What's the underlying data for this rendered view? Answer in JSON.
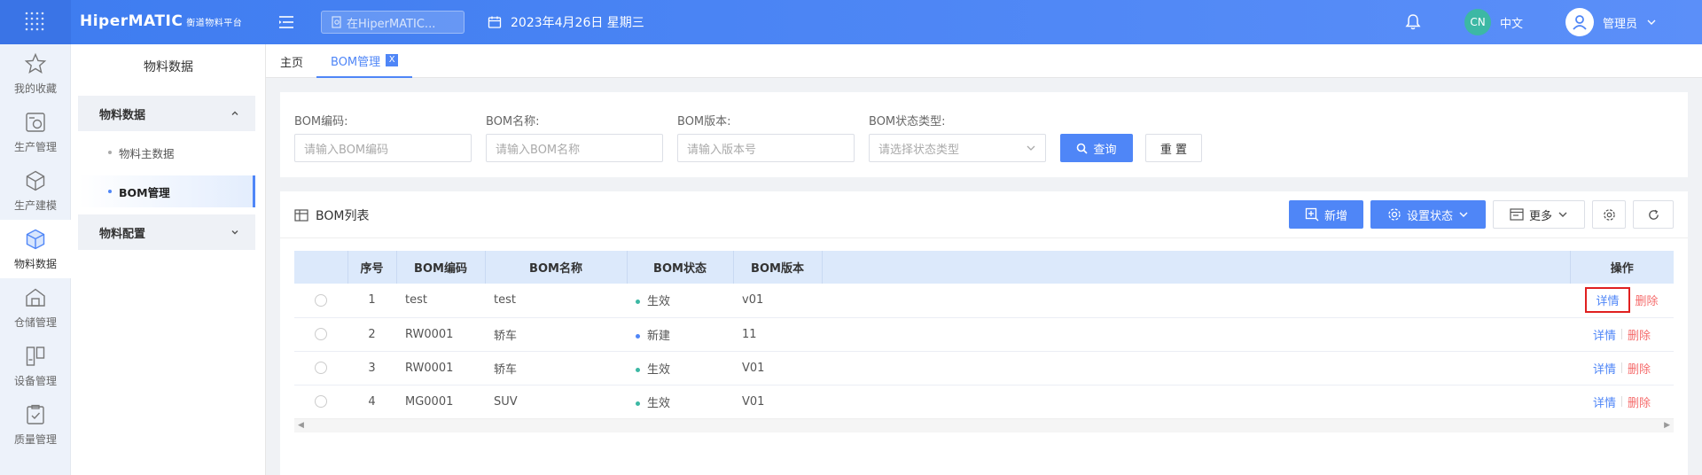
{
  "header": {
    "logo_main": "HiperMATIC",
    "logo_sub": "衡道物料平台",
    "search_placeholder": "在HiperMATIC...",
    "date_text": "2023年4月26日 星期三",
    "lang_badge": "CN",
    "lang_label": "中文",
    "user_name": "管理员"
  },
  "rail": {
    "items": [
      {
        "label": "我的收藏",
        "icon": "star-icon"
      },
      {
        "label": "生产管理",
        "icon": "production-icon"
      },
      {
        "label": "生产建模",
        "icon": "cube-icon"
      },
      {
        "label": "物料数据",
        "icon": "material-icon"
      },
      {
        "label": "仓储管理",
        "icon": "warehouse-icon"
      },
      {
        "label": "设备管理",
        "icon": "equipment-icon"
      },
      {
        "label": "质量管理",
        "icon": "quality-icon"
      }
    ]
  },
  "sidebar": {
    "title": "物料数据",
    "group1": "物料数据",
    "sub1": "物料主数据",
    "sub2": "BOM管理",
    "group2": "物料配置"
  },
  "tabs": {
    "home": "主页",
    "current": "BOM管理",
    "close": "X"
  },
  "filter": {
    "code_label": "BOM编码:",
    "code_placeholder": "请输入BOM编码",
    "name_label": "BOM名称:",
    "name_placeholder": "请输入BOM名称",
    "version_label": "BOM版本:",
    "version_placeholder": "请输入版本号",
    "status_label": "BOM状态类型:",
    "status_placeholder": "请选择状态类型",
    "query_label": "查询",
    "reset_label": "重 置"
  },
  "list": {
    "title": "BOM列表",
    "add_label": "新增",
    "set_status_label": "设置状态",
    "more_label": "更多",
    "columns": [
      "序号",
      "BOM编码",
      "BOM名称",
      "BOM状态",
      "BOM版本",
      "操作"
    ],
    "rows": [
      {
        "index": "1",
        "code": "test",
        "name": "test",
        "status": "生效",
        "status_color": "#3cb8a4",
        "version": "v01",
        "detail": "详情",
        "delete": "删除"
      },
      {
        "index": "2",
        "code": "RW0001",
        "name": "轿车",
        "status": "新建",
        "status_color": "#4f86f7",
        "version": "11",
        "detail": "详情",
        "delete": "删除"
      },
      {
        "index": "3",
        "code": "RW0001",
        "name": "轿车",
        "status": "生效",
        "status_color": "#3cb8a4",
        "version": "V01",
        "detail": "详情",
        "delete": "删除"
      },
      {
        "index": "4",
        "code": "MG0001",
        "name": "SUV",
        "status": "生效",
        "status_color": "#3cb8a4",
        "version": "V01",
        "detail": "详情",
        "delete": "删除"
      }
    ]
  },
  "colors": {
    "primary": "#4f86f7",
    "danger": "#f56c6c",
    "highlight": "#e02020"
  }
}
